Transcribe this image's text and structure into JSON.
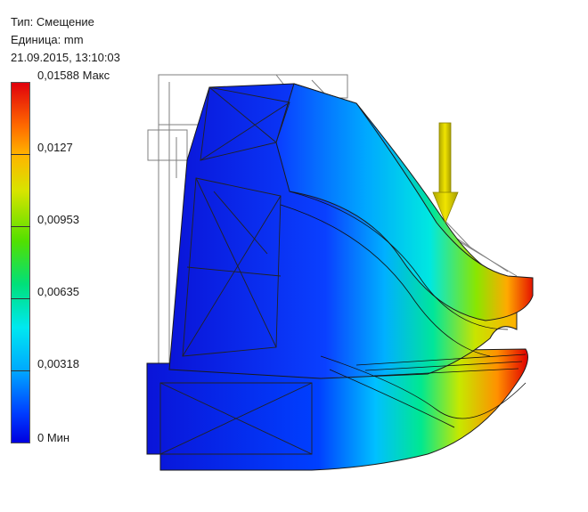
{
  "header": {
    "type_line": "Тип: Смещение",
    "unit_line": "Единица: mm",
    "timestamp": "21.09.2015, 13:10:03"
  },
  "legend": {
    "labels": {
      "max": "0,01588 Макс",
      "l4": "0,0127",
      "l3": "0,00953",
      "l2": "0,00635",
      "l1": "0,00318",
      "min": "0 Мин"
    },
    "colors": {
      "max": "#e0000c",
      "min": "#0000e0",
      "mid": "#52e000"
    }
  },
  "load_arrow": {
    "icon": "down-arrow-icon",
    "color": "#d8d000"
  }
}
